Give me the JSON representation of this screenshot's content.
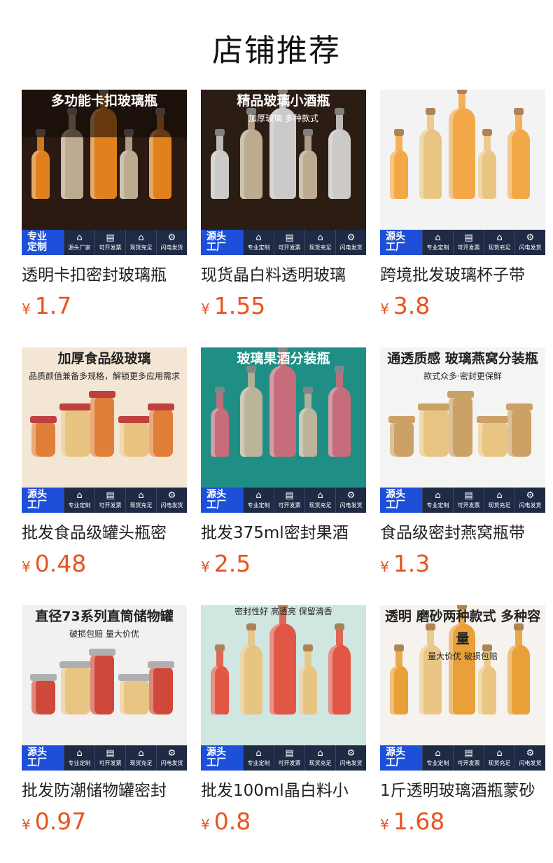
{
  "section_title": "店铺推荐",
  "currency_symbol": "¥",
  "badge_strip": {
    "first_card": "专业\n定制",
    "first_other": "源头\n工厂",
    "card1_features": [
      "源头厂家",
      "可开发票",
      "现货充足",
      "闪电发货"
    ],
    "other_features": [
      "专业定制",
      "可开发票",
      "现货充足",
      "闪电发货"
    ]
  },
  "products": [
    {
      "name": "透明卡扣密封玻璃瓶",
      "price": "1.7",
      "banner": "多功能卡扣玻璃瓶",
      "banner_sub": "",
      "theme": "#2a1a12",
      "accent": "#f08a20"
    },
    {
      "name": "现货晶白料透明玻璃",
      "price": "1.55",
      "banner": "精品玻璃小酒瓶",
      "banner_sub": "加厚玻璃 多种款式",
      "theme": "#2b1d14",
      "accent": "#d9d9d9"
    },
    {
      "name": "跨境批发玻璃杯子带",
      "price": "3.8",
      "banner": "",
      "banner_sub": "",
      "theme": "#f3f3f3",
      "accent": "#f4a23a"
    },
    {
      "name": "批发食品级罐头瓶密",
      "price": "0.48",
      "banner": "加厚食品级玻璃",
      "banner_sub": "品质颜值兼备多规格，解锁更多应用需求",
      "theme": "#f3e6d5",
      "accent": "#e0762b"
    },
    {
      "name": "批发375ml密封果酒",
      "price": "2.5",
      "banner": "玻璃果酒分装瓶",
      "banner_sub": "",
      "theme": "#1f8f86",
      "accent": "#d66a7a"
    },
    {
      "name": "食品级密封燕窝瓶带",
      "price": "1.3",
      "banner": "通透质感 玻璃燕窝分装瓶",
      "banner_sub": "款式众多·密封更保鲜",
      "theme": "#f4f4f2",
      "accent": "#c89a5a"
    },
    {
      "name": "批发防潮储物罐密封",
      "price": "0.97",
      "banner": "直径73系列直筒储物罐",
      "banner_sub": "破损包赔 量大价优",
      "theme": "#f1f1f1",
      "accent": "#cc3b2a"
    },
    {
      "name": "批发100ml晶白料小",
      "price": "0.8",
      "banner": "",
      "banner_sub": "密封性好 高透亮 保留清香",
      "theme": "#cfe7e0",
      "accent": "#e44a3a"
    },
    {
      "name": "1斤透明玻璃酒瓶蒙砂",
      "price": "1.68",
      "banner": "透明 磨砂两种款式 多种容量",
      "banner_sub": "量大价优 破损包赔",
      "theme": "#f6f3ee",
      "accent": "#e89a2a"
    }
  ]
}
